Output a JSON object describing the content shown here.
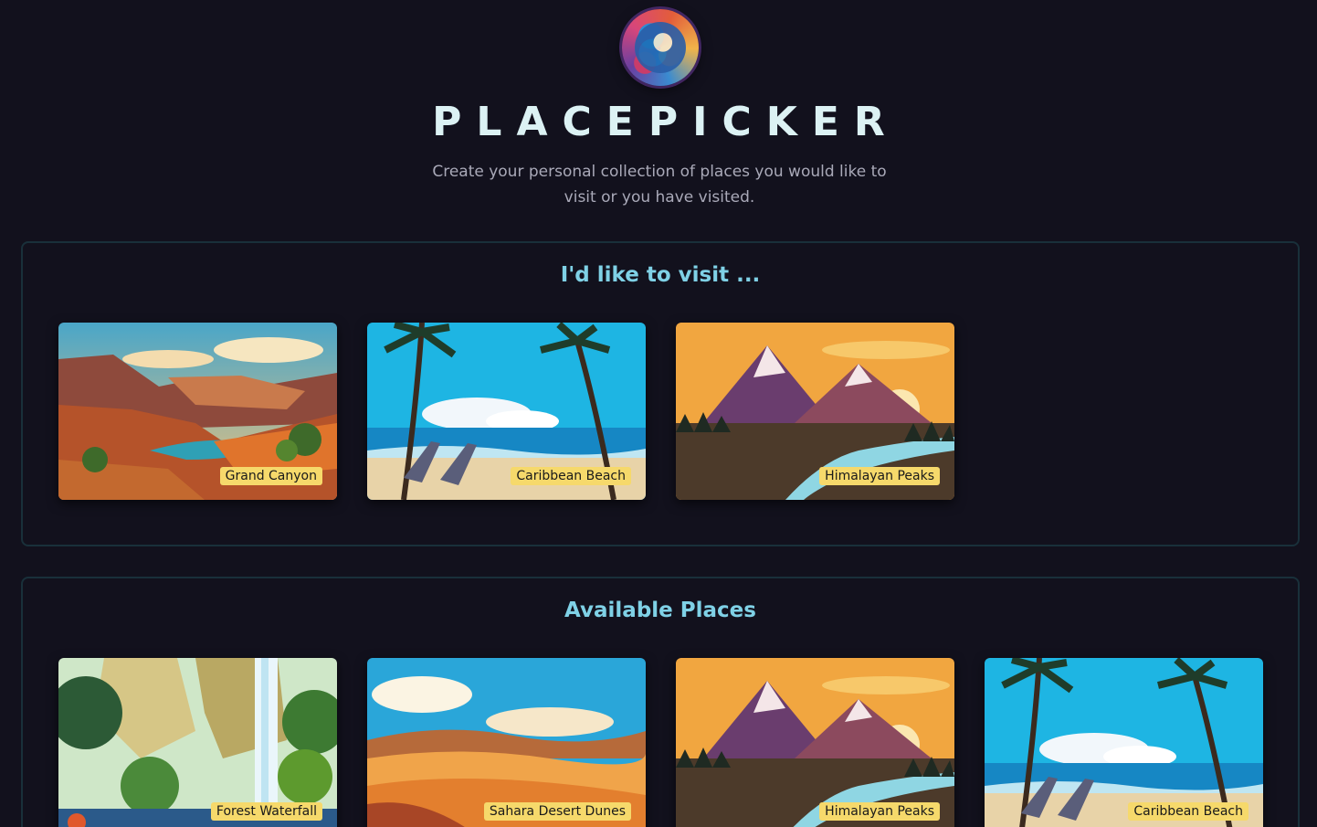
{
  "header": {
    "logo": "globe-logo",
    "title": "PLACEPICKER",
    "subtitle": "Create your personal collection of places you would like to visit or you have visited."
  },
  "visit": {
    "title": "I'd like to visit ...",
    "places": [
      {
        "label": "Grand Canyon",
        "scene": "canyon"
      },
      {
        "label": "Caribbean Beach",
        "scene": "beach"
      },
      {
        "label": "Himalayan Peaks",
        "scene": "mountains"
      }
    ]
  },
  "available": {
    "title": "Available Places",
    "places": [
      {
        "label": "Forest Waterfall",
        "scene": "waterfall"
      },
      {
        "label": "Sahara Desert Dunes",
        "scene": "desert"
      },
      {
        "label": "Himalayan Peaks",
        "scene": "mountains"
      },
      {
        "label": "Caribbean Beach",
        "scene": "beach"
      }
    ]
  },
  "colors": {
    "background": "#12111d",
    "accent": "#7fd1e6",
    "label_bg": "#f6d96b",
    "section_border": "#19303a"
  }
}
